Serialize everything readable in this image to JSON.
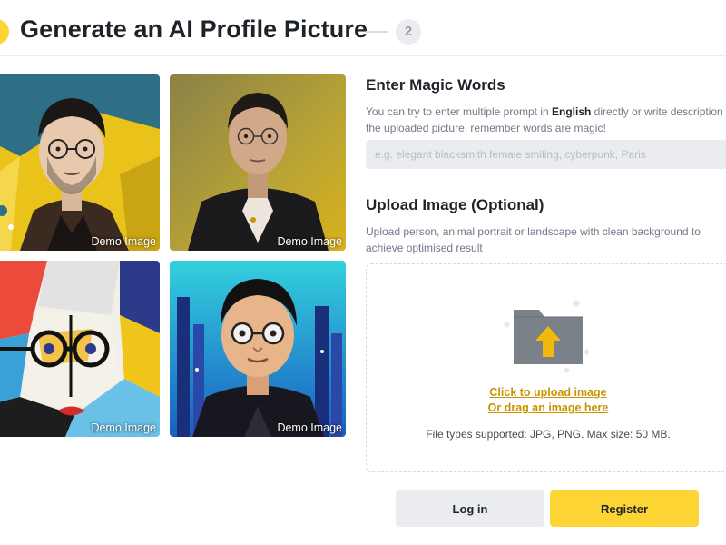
{
  "header": {
    "title": "Generate an AI Profile Picture",
    "step_two": "2"
  },
  "demo_images": [
    {
      "caption": "Demo Image"
    },
    {
      "caption": "Demo Image"
    },
    {
      "caption": "Demo Image"
    },
    {
      "caption": "Demo Image"
    }
  ],
  "magic": {
    "title": "Enter Magic Words",
    "desc_before": "You can try to enter multiple prompt in ",
    "desc_bold": "English",
    "desc_after": " directly or write description of",
    "desc_line2": "the uploaded picture, remember words are magic!",
    "placeholder": "e.g. elegant blacksmith female smiling, cyberpunk, Paris",
    "value": ""
  },
  "upload": {
    "title": "Upload Image (Optional)",
    "desc": "Upload person, animal portrait or landscape with clean background to achieve optimised result",
    "click_label": "Click to upload image",
    "drag_label": "Or drag an image here",
    "hint": "File types supported: JPG, PNG. Max size: 50 MB."
  },
  "actions": {
    "login_label": "Log in",
    "register_label": "Register"
  },
  "colors": {
    "accent": "#fcd535",
    "link": "#c99400",
    "text_primary": "#1e2329",
    "text_secondary": "#707a8a"
  }
}
